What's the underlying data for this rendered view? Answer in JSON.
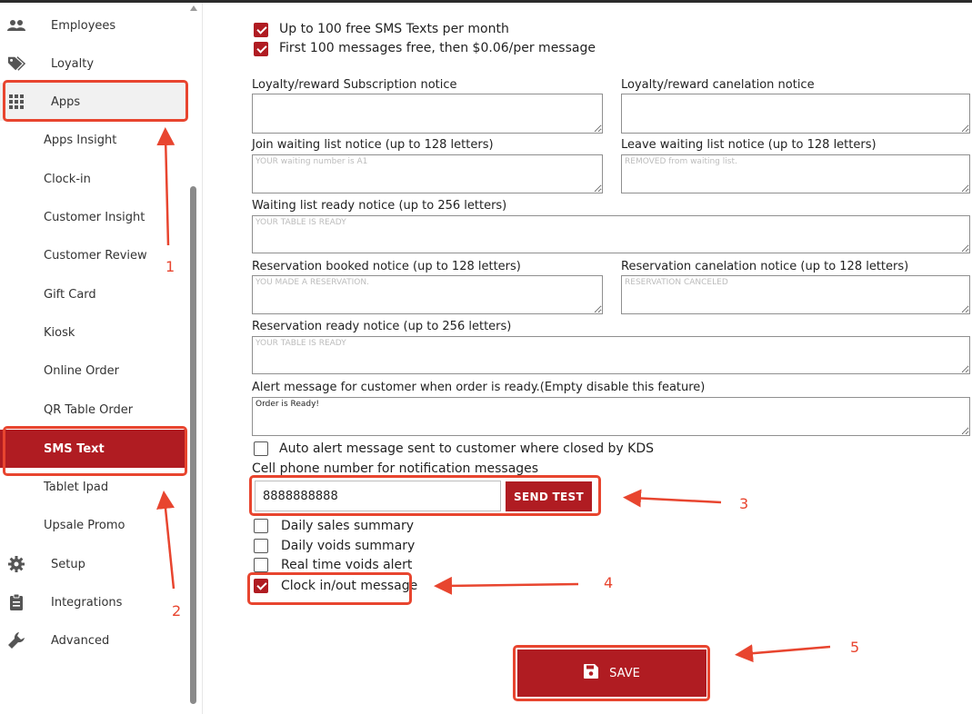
{
  "sidebar": {
    "items": [
      {
        "label": "Employees",
        "icon": "people-icon"
      },
      {
        "label": "Loyalty",
        "icon": "tags-icon"
      },
      {
        "label": "Apps",
        "icon": "grid-icon"
      },
      {
        "label": "Apps Insight"
      },
      {
        "label": "Clock-in"
      },
      {
        "label": "Customer Insight"
      },
      {
        "label": "Customer Review"
      },
      {
        "label": "Gift Card"
      },
      {
        "label": "Kiosk"
      },
      {
        "label": "Online Order"
      },
      {
        "label": "QR Table Order"
      },
      {
        "label": "SMS Text"
      },
      {
        "label": "Tablet Ipad"
      },
      {
        "label": "Upsale Promo"
      },
      {
        "label": "Setup",
        "icon": "gear-icon"
      },
      {
        "label": "Integrations",
        "icon": "clipboard-icon"
      },
      {
        "label": "Advanced",
        "icon": "wrench-icon"
      }
    ],
    "active_item": "SMS Text"
  },
  "plan": {
    "option1": {
      "label": "Up to 100 free SMS Texts per month",
      "checked": true
    },
    "option2": {
      "label": "First 100 messages free, then $0.06/per message",
      "checked": true
    }
  },
  "fields": {
    "loyalty_subscription": {
      "label": "Loyalty/reward Subscription notice",
      "value": "",
      "placeholder": ""
    },
    "loyalty_cancel": {
      "label": "Loyalty/reward canelation notice",
      "value": "",
      "placeholder": ""
    },
    "join_waiting": {
      "label": "Join waiting list notice (up to 128 letters)",
      "value": "",
      "placeholder": "YOUR waiting number is A1"
    },
    "leave_waiting": {
      "label": "Leave waiting list notice (up to 128 letters)",
      "value": "",
      "placeholder": "REMOVED from waiting list."
    },
    "waiting_ready": {
      "label": "Waiting list ready notice (up to 256 letters)",
      "value": "",
      "placeholder": "YOUR TABLE IS READY"
    },
    "reservation_booked": {
      "label": "Reservation booked notice (up to 128 letters)",
      "value": "",
      "placeholder": "YOU MADE A RESERVATION."
    },
    "reservation_cancel": {
      "label": "Reservation canelation notice (up to 128 letters)",
      "value": "",
      "placeholder": "RESERVATION CANCELED"
    },
    "reservation_ready": {
      "label": "Reservation ready notice (up to 256 letters)",
      "value": "",
      "placeholder": "YOUR TABLE IS READY"
    },
    "order_ready_alert": {
      "label": "Alert message for customer when order is ready.(Empty disable this feature)",
      "value": "Order is Ready!",
      "placeholder": ""
    }
  },
  "auto_alert": {
    "label": "Auto alert message sent to customer where closed by KDS",
    "checked": false
  },
  "phone": {
    "label": "Cell phone number for notification messages",
    "value": "8888888888",
    "send_test_label": "SEND TEST"
  },
  "notifications": [
    {
      "label": "Daily sales summary",
      "checked": false
    },
    {
      "label": "Daily voids summary",
      "checked": false
    },
    {
      "label": "Real time voids alert",
      "checked": false
    },
    {
      "label": "Clock in/out message",
      "checked": true
    }
  ],
  "save_label": "SAVE",
  "annotations": {
    "n1": "1",
    "n2": "2",
    "n3": "3",
    "n4": "4",
    "n5": "5",
    "color": "#e8452f"
  },
  "colors": {
    "brand": "#b01c22",
    "annotation": "#e8452f"
  }
}
